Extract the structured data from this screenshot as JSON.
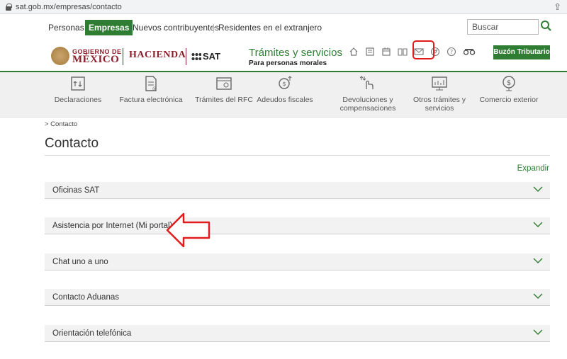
{
  "browser": {
    "url": "sat.gob.mx/empresas/contacto"
  },
  "topnav": {
    "items": [
      "Personas",
      "Empresas",
      "Nuevos contribuyentes",
      "Residentes en el extranjero"
    ],
    "active": "Empresas",
    "search_placeholder": "Buscar"
  },
  "header": {
    "gob_line1": "GOBIERNO DE",
    "gob_line2": "MÉXICO",
    "hacienda": "HACIENDA",
    "sat": "SAT",
    "tramites_title": "Trámites y servicios",
    "tramites_sub": "Para personas morales",
    "buzon": "Buzón Tributario",
    "icons": [
      "home-icon",
      "document-icon",
      "calendar-icon",
      "book-icon",
      "mail-icon",
      "compass-icon",
      "help-icon",
      "binoculars-icon"
    ]
  },
  "services": [
    {
      "label": "Declaraciones",
      "icon": "declaraciones-icon"
    },
    {
      "label": "Factura electrónica",
      "icon": "factura-icon"
    },
    {
      "label": "Trámites del RFC",
      "icon": "rfc-icon"
    },
    {
      "label": "Adeudos fiscales",
      "icon": "adeudos-icon"
    },
    {
      "label": "Devoluciones y compensaciones",
      "icon": "devoluciones-icon"
    },
    {
      "label": "Otros trámites y servicios",
      "icon": "otros-tramites-icon"
    },
    {
      "label": "Comercio exterior",
      "icon": "comercio-exterior-icon"
    }
  ],
  "breadcrumb": "> Contacto",
  "page_title": "Contacto",
  "expand_label": "Expandir",
  "accordion": [
    {
      "label": "Oficinas SAT"
    },
    {
      "label": "Asistencia por Internet (Mi portal)"
    },
    {
      "label": "Chat uno a uno"
    },
    {
      "label": "Contacto Aduanas"
    },
    {
      "label": "Orientación telefónica"
    }
  ],
  "colors": {
    "green": "#2e7d32",
    "maroon": "#8b1f2b",
    "annotation_red": "#e21b1b"
  }
}
